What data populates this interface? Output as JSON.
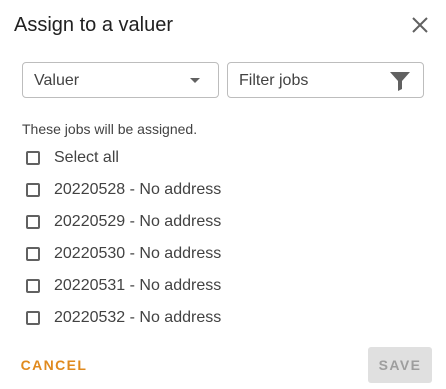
{
  "dialog": {
    "title": "Assign to a valuer"
  },
  "valuer_select": {
    "value": "Valuer",
    "icon": "dropdown-arrow-icon"
  },
  "filter": {
    "placeholder": "Filter jobs",
    "icon": "filter-icon"
  },
  "hint": "These jobs will be assigned.",
  "select_all": {
    "label": "Select all",
    "checked": false
  },
  "jobs": [
    {
      "label": "20220528 - No address",
      "checked": false
    },
    {
      "label": "20220529 - No address",
      "checked": false
    },
    {
      "label": "20220530 - No address",
      "checked": false
    },
    {
      "label": "20220531 - No address",
      "checked": false
    },
    {
      "label": "20220532 - No address",
      "checked": false
    }
  ],
  "actions": {
    "cancel_label": "CANCEL",
    "save_label": "SAVE",
    "save_enabled": false
  },
  "colors": {
    "accent": "#e08a1e",
    "disabled_bg": "#e0e0e0",
    "disabled_text": "#9e9e9e"
  }
}
